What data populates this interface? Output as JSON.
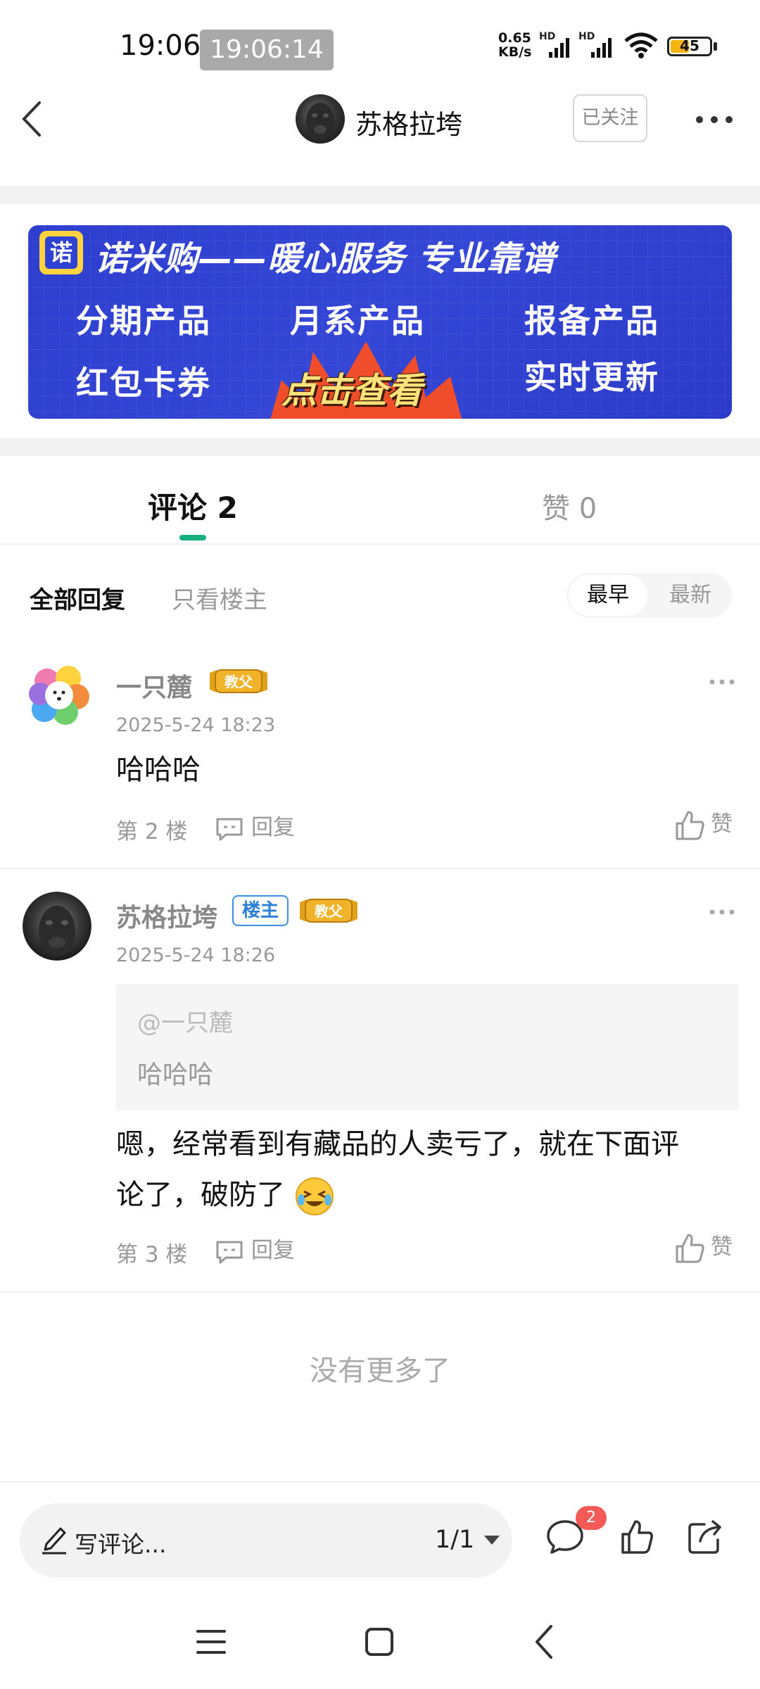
{
  "status_bar": {
    "time": "19:06",
    "time_badge": "19:06:14",
    "net_speed_value": "0.65",
    "net_speed_unit": "KB/s",
    "hd_label": "HD",
    "battery": "45"
  },
  "header": {
    "author_name": "苏格拉垮",
    "follow_label": "已关注"
  },
  "banner": {
    "logo_char": "诺",
    "title": "诺米购——暖心服务 专业靠谱",
    "items": [
      "分期产品",
      "月系产品",
      "报备产品",
      "红包卡券",
      "实时更新"
    ],
    "cta": "点击查看"
  },
  "tabs": {
    "comment_label": "评论 2",
    "like_label": "赞 0"
  },
  "filters": {
    "all": "全部回复",
    "op_only": "只看楼主",
    "sort_early": "最早",
    "sort_new": "最新"
  },
  "comments": [
    {
      "user": "一只麓",
      "badge": "教父",
      "time": "2025-5-24 18:23",
      "text": "哈哈哈",
      "floor": "第 2 楼",
      "reply_label": "回复",
      "like_label": "赞"
    },
    {
      "user": "苏格拉垮",
      "op_badge": "楼主",
      "badge": "教父",
      "time": "2025-5-24 18:26",
      "quote_user": "@一只麓",
      "quote_text": "哈哈哈",
      "text_line1": "嗯，经常看到有藏品的人卖亏了，就在下面评",
      "text_line2": "论了，破防了",
      "floor": "第 3 楼",
      "reply_label": "回复",
      "like_label": "赞"
    }
  ],
  "footer": {
    "no_more": "没有更多了"
  },
  "bottom_bar": {
    "write_placeholder": "写评论...",
    "page_indicator": "1/1",
    "comment_count": "2"
  },
  "colors": {
    "accent": "#19b07f",
    "banner": "#2e3fcf",
    "badge_red": "#f25a57",
    "op_blue": "#2a7fd9"
  }
}
